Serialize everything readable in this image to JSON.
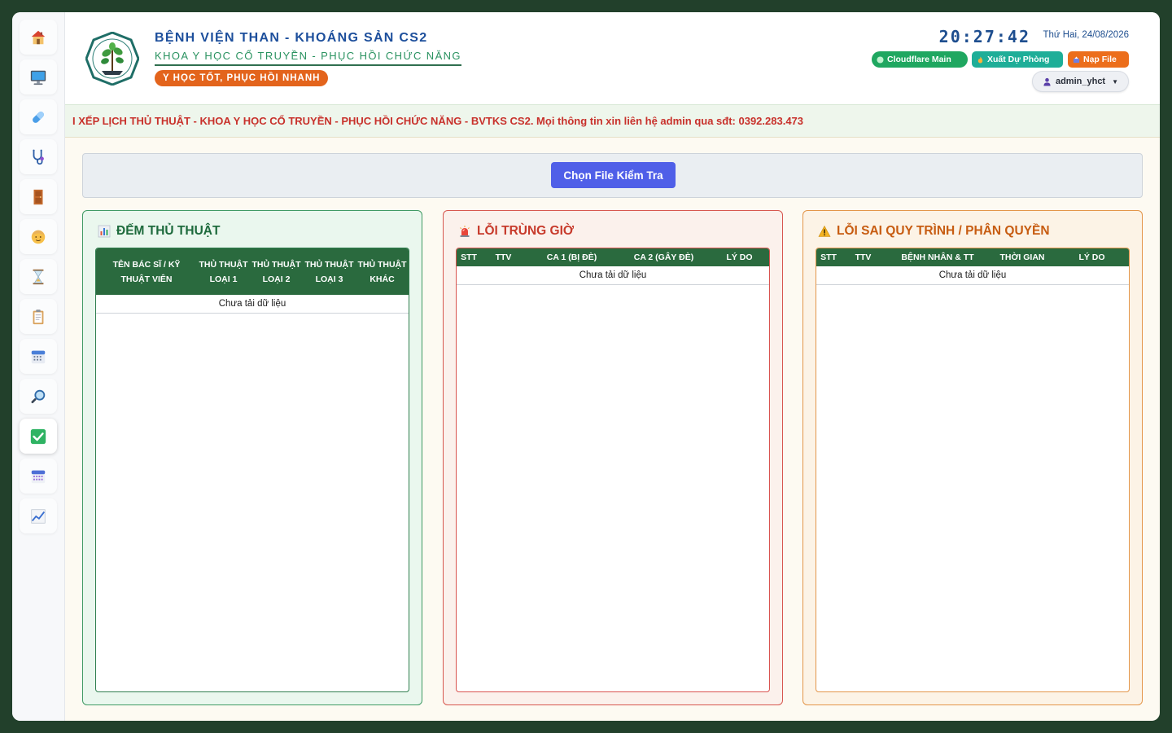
{
  "sidebar": {
    "items": [
      {
        "name": "home-icon"
      },
      {
        "name": "monitor-icon"
      },
      {
        "name": "pill-icon"
      },
      {
        "name": "stethoscope-icon"
      },
      {
        "name": "door-icon"
      },
      {
        "name": "person-icon"
      },
      {
        "name": "hourglass-icon"
      },
      {
        "name": "clipboard-icon"
      },
      {
        "name": "calendar-icon"
      },
      {
        "name": "magnifier-icon"
      },
      {
        "name": "check-icon",
        "active": true
      },
      {
        "name": "calendar-grid-icon"
      },
      {
        "name": "chart-icon"
      }
    ]
  },
  "header": {
    "title": "BỆNH VIỆN THAN - KHOÁNG SẢN CS2",
    "subtitle": "KHOA Y HỌC CỔ TRUYỀN - PHỤC HỒI CHỨC NĂNG",
    "slogan": "Y HỌC TỐT, PHỤC HỒI NHANH",
    "clock": "20:27:42",
    "date": "Thứ Hai, 24/08/2026",
    "buttons": {
      "cloudflare": "Cloudflare Main",
      "backup_export": "Xuất Dự Phòng",
      "load_file": "Nạp File"
    },
    "user": "admin_yhct"
  },
  "marquee": "I XẾP LỊCH THỦ THUẬT - KHOA Y HỌC CỔ TRUYỀN - PHỤC HỒI CHỨC NĂNG - BVTKS CS2. Mọi thông tin xin liên hệ admin qua sđt: 0392.283.473",
  "toolbar": {
    "choose_file": "Chọn File Kiểm Tra"
  },
  "panels": {
    "count": {
      "title": "ĐẾM THỦ THUẬT",
      "headers": [
        "TÊN BÁC SĨ / KỸ THUẬT VIÊN",
        "THỦ THUẬT LOẠI 1",
        "THỦ THUẬT LOẠI 2",
        "THỦ THUẬT LOẠI 3",
        "THỦ THUẬT KHÁC"
      ],
      "empty": "Chưa tải dữ liệu"
    },
    "overlap": {
      "title": "LỖI TRÙNG GIỜ",
      "headers": [
        "STT",
        "TTV",
        "CA 1 (BỊ ĐÈ)",
        "CA 2 (GÂY ĐÈ)",
        "LÝ DO"
      ],
      "empty": "Chưa tải dữ liệu"
    },
    "process": {
      "title": "LỖI SAI QUY TRÌNH / PHÂN QUYỀN",
      "headers": [
        "STT",
        "TTV",
        "BỆNH NHÂN & TT",
        "THỜI GIAN",
        "LÝ DO"
      ],
      "empty": "Chưa tải dữ liệu"
    }
  },
  "colors": {
    "primary_green": "#2a6a3e",
    "accent_blue": "#4f5fe8",
    "marquee_red": "#c8312b"
  }
}
